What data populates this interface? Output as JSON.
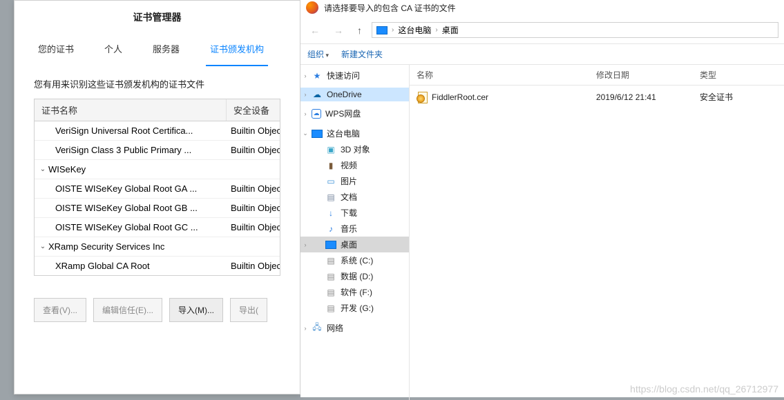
{
  "cert_manager": {
    "title": "证书管理器",
    "tabs": [
      "您的证书",
      "个人",
      "服务器",
      "证书颁发机构"
    ],
    "active_tab": 3,
    "description": "您有用来识别这些证书颁发机构的证书文件",
    "columns": [
      "证书名称",
      "安全设备"
    ],
    "groups": [
      {
        "name": "",
        "expanded": false,
        "rows": [
          {
            "name": "VeriSign Universal Root Certifica...",
            "device": "Builtin Object"
          },
          {
            "name": "VeriSign Class 3 Public Primary ...",
            "device": "Builtin Object"
          }
        ]
      },
      {
        "name": "WISeKey",
        "expanded": true,
        "rows": [
          {
            "name": "OISTE WISeKey Global Root GA ...",
            "device": "Builtin Object"
          },
          {
            "name": "OISTE WISeKey Global Root GB ...",
            "device": "Builtin Object"
          },
          {
            "name": "OISTE WISeKey Global Root GC ...",
            "device": "Builtin Object"
          }
        ]
      },
      {
        "name": "XRamp Security Services Inc",
        "expanded": true,
        "rows": [
          {
            "name": "XRamp Global CA Root",
            "device": "Builtin Object"
          }
        ]
      }
    ],
    "buttons": {
      "view": "查看(V)...",
      "edit_trust": "编辑信任(E)...",
      "import": "导入(M)...",
      "export": "导出("
    }
  },
  "file_dialog": {
    "title": "请选择要导入的包含 CA 证书的文件",
    "path": {
      "pc": "这台电脑",
      "location": "桌面"
    },
    "toolbar": {
      "organize": "组织",
      "new_folder": "新建文件夹"
    },
    "tree": {
      "quick": "快速访问",
      "onedrive": "OneDrive",
      "wps": "WPS网盘",
      "pc": "这台电脑",
      "pc_children": [
        {
          "label": "3D 对象",
          "icon": "3d"
        },
        {
          "label": "视频",
          "icon": "video"
        },
        {
          "label": "图片",
          "icon": "image"
        },
        {
          "label": "文档",
          "icon": "doc"
        },
        {
          "label": "下载",
          "icon": "download"
        },
        {
          "label": "音乐",
          "icon": "music"
        },
        {
          "label": "桌面",
          "icon": "desktop",
          "selected": true
        },
        {
          "label": "系统 (C:)",
          "icon": "drive"
        },
        {
          "label": "数据 (D:)",
          "icon": "drive"
        },
        {
          "label": "软件 (F:)",
          "icon": "drive"
        },
        {
          "label": "开发 (G:)",
          "icon": "drive"
        }
      ],
      "network": "网络"
    },
    "list": {
      "headers": {
        "name": "名称",
        "date": "修改日期",
        "type": "类型"
      },
      "rows": [
        {
          "name": "FiddlerRoot.cer",
          "date": "2019/6/12 21:41",
          "type": "安全证书"
        }
      ]
    }
  },
  "watermark": "https://blog.csdn.net/qq_26712977"
}
